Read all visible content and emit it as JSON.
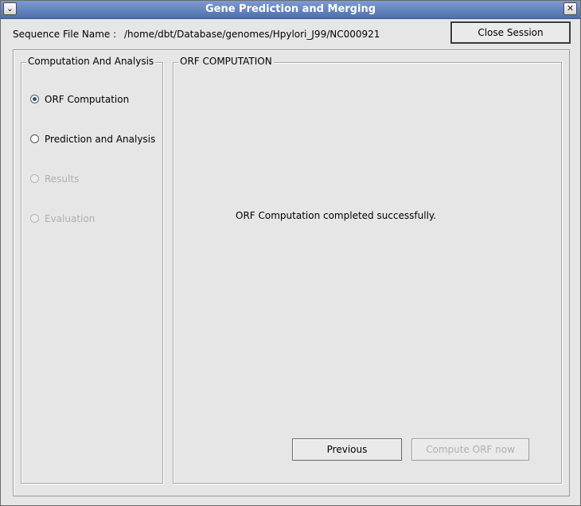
{
  "window": {
    "title": "Gene Prediction and Merging",
    "menu_glyph": "⌄",
    "close_glyph": "✕"
  },
  "header": {
    "sequence_label": "Sequence File Name :",
    "sequence_path": "/home/dbt/Database/genomes/Hpylori_J99/NC000921",
    "close_session_label": "Close Session"
  },
  "left_panel": {
    "title": "Computation And Analysis",
    "options": [
      {
        "label": "ORF Computation",
        "selected": true,
        "enabled": true
      },
      {
        "label": "Prediction and Analysis",
        "selected": false,
        "enabled": true
      },
      {
        "label": "Results",
        "selected": false,
        "enabled": false
      },
      {
        "label": "Evaluation",
        "selected": false,
        "enabled": false
      }
    ]
  },
  "right_panel": {
    "title": "ORF COMPUTATION",
    "status_message": "ORF Computation completed successfully.",
    "previous_label": "Previous",
    "compute_label": "Compute ORF now",
    "compute_enabled": false
  }
}
